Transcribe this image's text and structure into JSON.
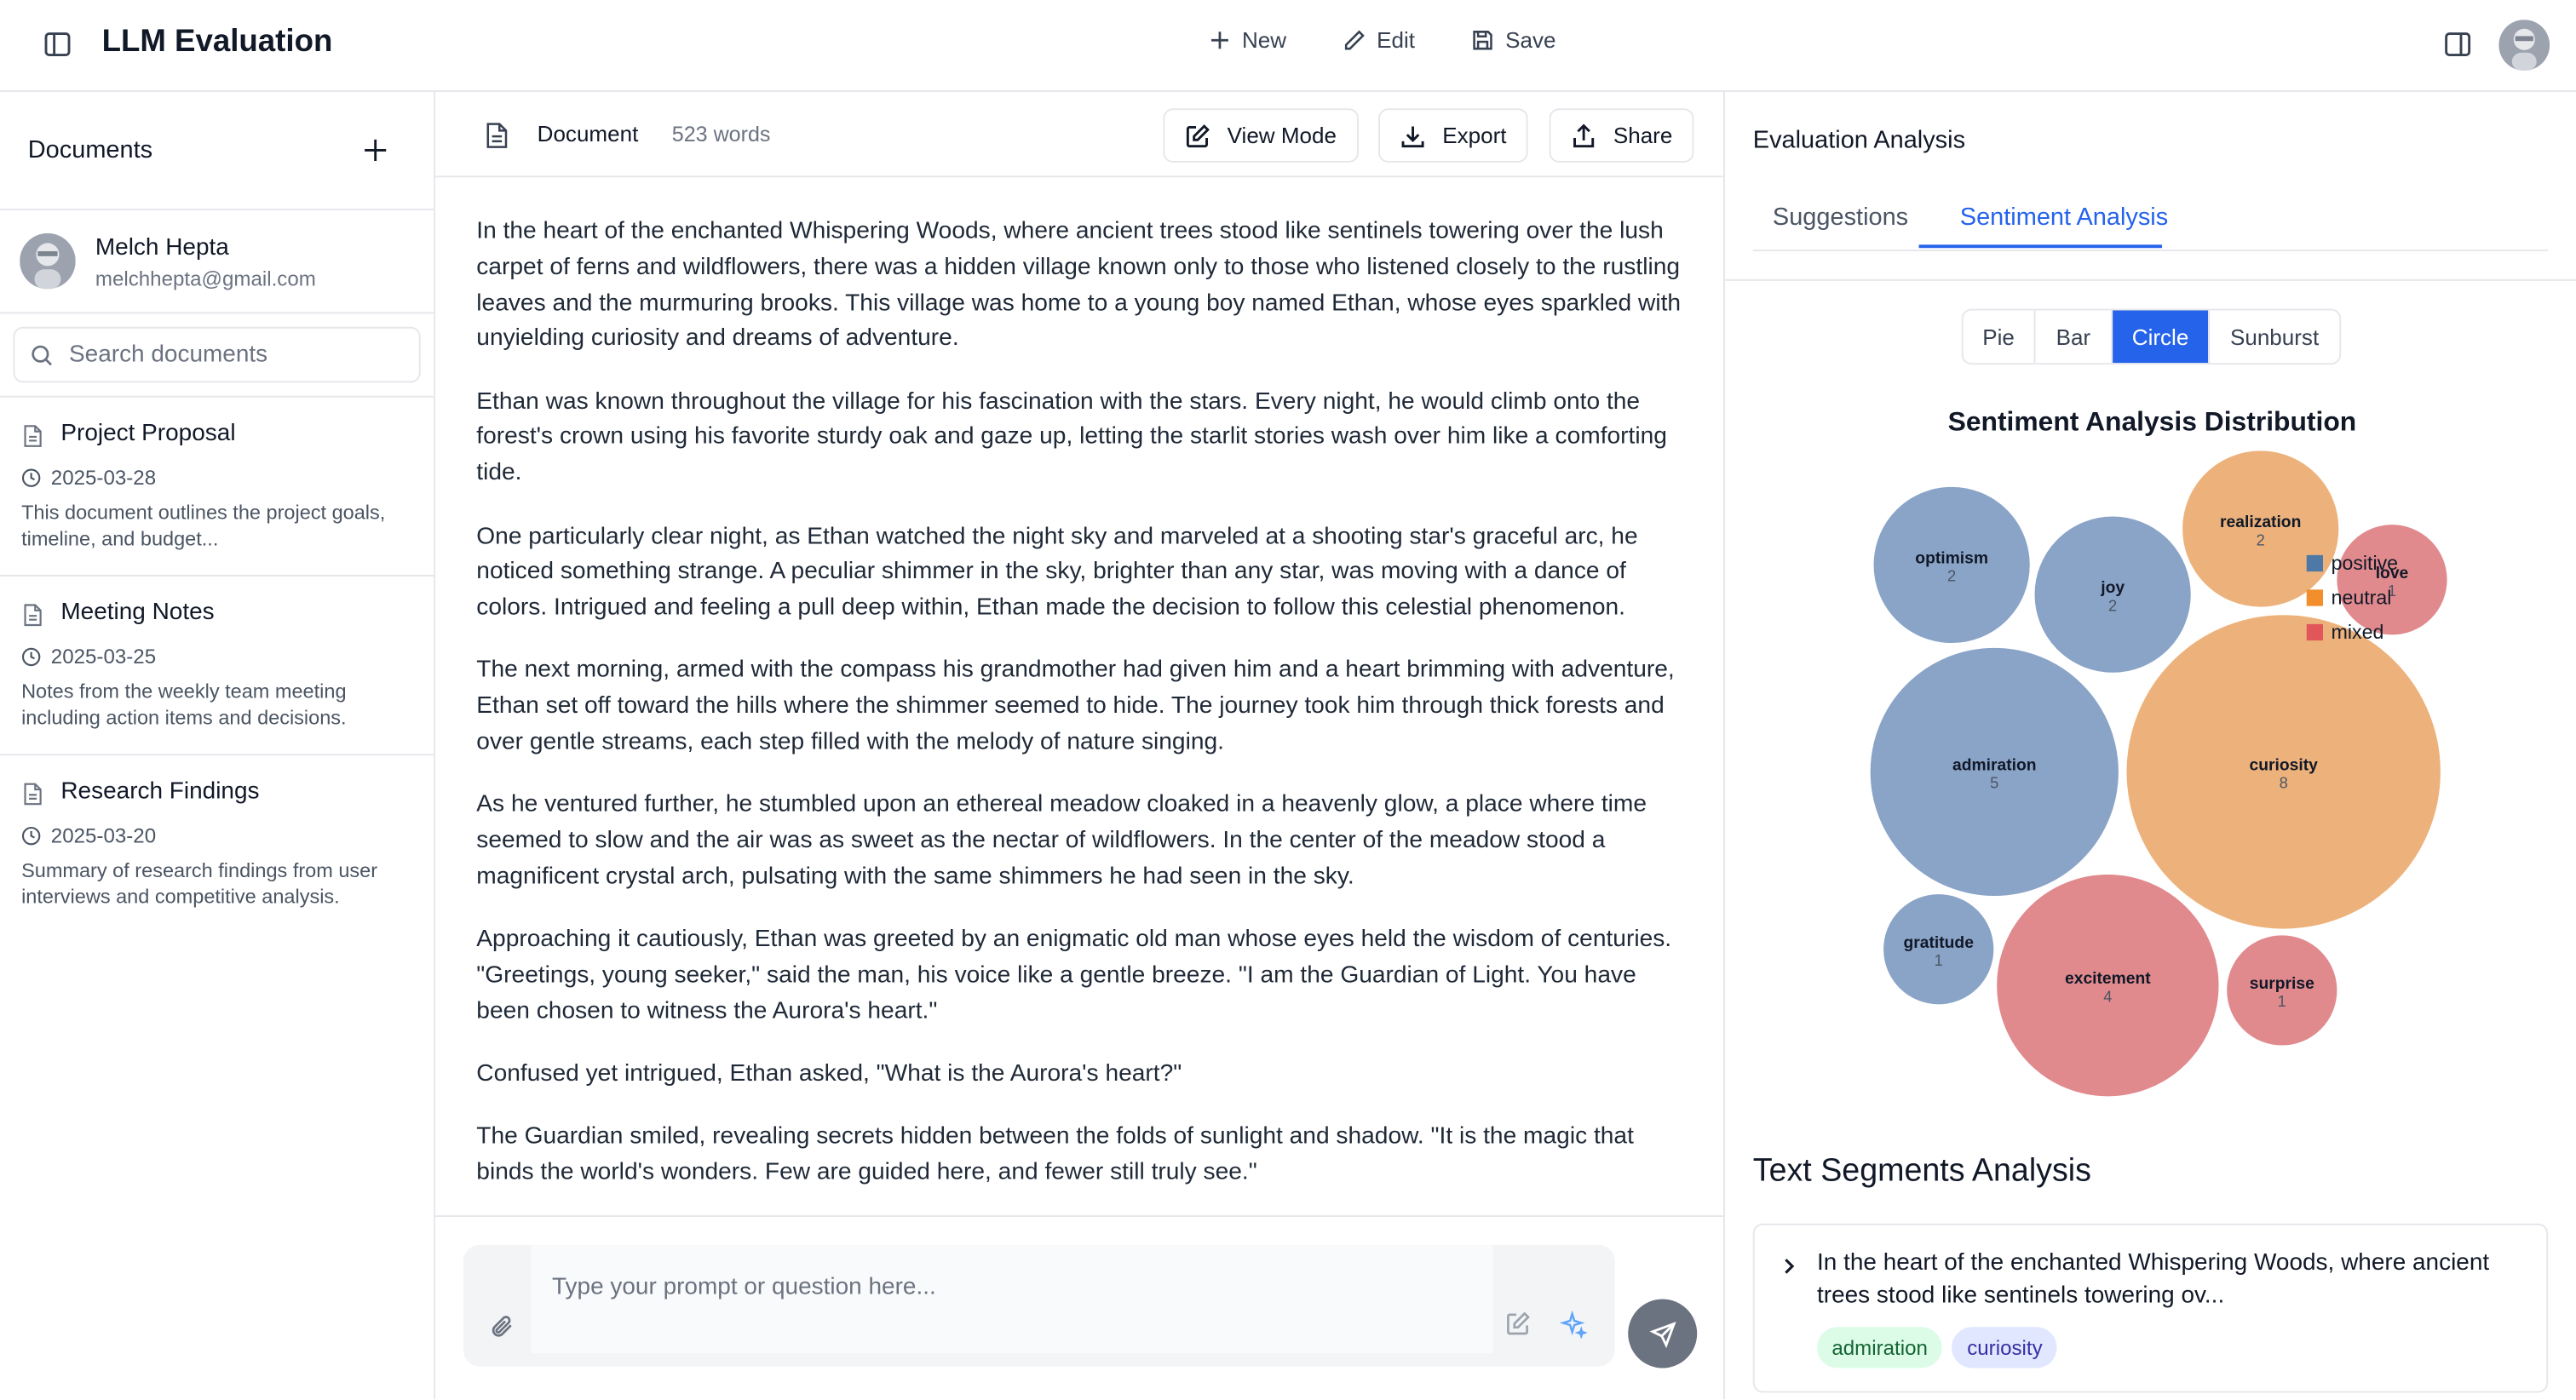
{
  "app": {
    "title": "LLM Evaluation"
  },
  "topbar": {
    "new_label": "New",
    "edit_label": "Edit",
    "save_label": "Save"
  },
  "sidebar": {
    "title": "Documents",
    "user": {
      "name": "Melch Hepta",
      "email": "melchhepta@gmail.com"
    },
    "search": {
      "placeholder": "Search documents"
    },
    "documents": [
      {
        "title": "Project Proposal",
        "date": "2025-03-28",
        "desc": "This document outlines the project goals, timeline, and budget..."
      },
      {
        "title": "Meeting Notes",
        "date": "2025-03-25",
        "desc": "Notes from the weekly team meeting including action items and decisions."
      },
      {
        "title": "Research Findings",
        "date": "2025-03-20",
        "desc": "Summary of research findings from user interviews and competitive analysis."
      }
    ]
  },
  "document": {
    "label": "Document",
    "word_count": "523 words",
    "view_mode_label": "View Mode",
    "export_label": "Export",
    "share_label": "Share",
    "paragraphs": [
      "In the heart of the enchanted Whispering Woods, where ancient trees stood like sentinels towering over the lush carpet of ferns and wildflowers, there was a hidden village known only to those who listened closely to the rustling leaves and the murmuring brooks. This village was home to a young boy named Ethan, whose eyes sparkled with unyielding curiosity and dreams of adventure.",
      "Ethan was known throughout the village for his fascination with the stars. Every night, he would climb onto the forest's crown using his favorite sturdy oak and gaze up, letting the starlit stories wash over him like a comforting tide.",
      "One particularly clear night, as Ethan watched the night sky and marveled at a shooting star's graceful arc, he noticed something strange. A peculiar shimmer in the sky, brighter than any star, was moving with a dance of colors. Intrigued and feeling a pull deep within, Ethan made the decision to follow this celestial phenomenon.",
      "The next morning, armed with the compass his grandmother had given him and a heart brimming with adventure, Ethan set off toward the hills where the shimmer seemed to hide. The journey took him through thick forests and over gentle streams, each step filled with the melody of nature singing.",
      "As he ventured further, he stumbled upon an ethereal meadow cloaked in a heavenly glow, a place where time seemed to slow and the air was as sweet as the nectar of wildflowers. In the center of the meadow stood a magnificent crystal arch, pulsating with the same shimmers he had seen in the sky.",
      "Approaching it cautiously, Ethan was greeted by an enigmatic old man whose eyes held the wisdom of centuries. \"Greetings, young seeker,\" said the man, his voice like a gentle breeze. \"I am the Guardian of Light. You have been chosen to witness the Aurora's heart.\"",
      "Confused yet intrigued, Ethan asked, \"What is the Aurora's heart?\"",
      "The Guardian smiled, revealing secrets hidden between the folds of sunlight and shadow. \"It is the magic that binds the world's wonders. Few are guided here, and fewer still truly see.\""
    ],
    "prompt_placeholder": "Type your prompt or question here..."
  },
  "evaluation": {
    "title": "Evaluation Analysis",
    "tabs": [
      {
        "label": "Suggestions"
      },
      {
        "label": "Sentiment Analysis"
      }
    ],
    "active_tab": "Sentiment Analysis",
    "chart_types": [
      {
        "label": "Pie"
      },
      {
        "label": "Bar"
      },
      {
        "label": "Circle"
      },
      {
        "label": "Sunburst"
      }
    ],
    "active_chart_type": "Circle",
    "segments_title": "Text Segments Analysis",
    "segment": {
      "text": "In the heart of the enchanted Whispering Woods, where ancient trees stood like sentinels towering ov...",
      "tags": [
        "admiration",
        "curiosity"
      ]
    }
  },
  "colors": {
    "positive": "#8aa4c8",
    "neutral": "#edb27b",
    "mixed": "#e08a8e",
    "accent": "#2563eb",
    "legend_positive": "#4e79a7",
    "legend_neutral": "#f28e2b",
    "legend_mixed": "#e15759"
  },
  "chart_data": {
    "type": "bubble",
    "title": "Sentiment Analysis Distribution",
    "legend": [
      "positive",
      "neutral",
      "mixed"
    ],
    "legend_position": "top-right",
    "points": [
      {
        "label": "optimism",
        "value": 2,
        "group": "positive"
      },
      {
        "label": "joy",
        "value": 2,
        "group": "positive"
      },
      {
        "label": "realization",
        "value": 2,
        "group": "neutral"
      },
      {
        "label": "love",
        "value": 1,
        "group": "mixed"
      },
      {
        "label": "admiration",
        "value": 5,
        "group": "positive"
      },
      {
        "label": "curiosity",
        "value": 8,
        "group": "neutral"
      },
      {
        "label": "gratitude",
        "value": 1,
        "group": "positive"
      },
      {
        "label": "excitement",
        "value": 4,
        "group": "mixed"
      },
      {
        "label": "surprise",
        "value": 1,
        "group": "mixed"
      }
    ]
  }
}
